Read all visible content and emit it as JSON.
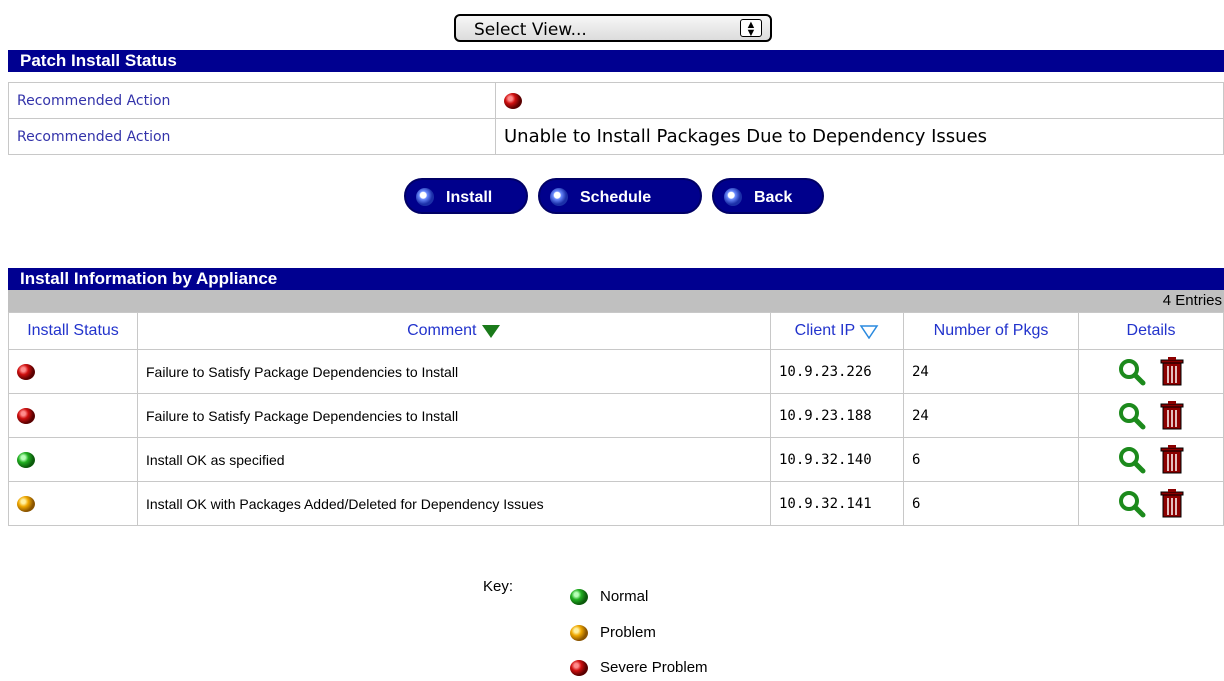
{
  "select_view": {
    "label": "Select View..."
  },
  "patch_status": {
    "header": "Patch Install Status",
    "rows": [
      {
        "label": "Recommended Action",
        "value": "",
        "status": "red"
      },
      {
        "label": "Recommended Action",
        "value": "Unable to Install Packages Due to Dependency Issues"
      }
    ]
  },
  "buttons": {
    "install": "Install",
    "schedule": "Schedule",
    "back": "Back"
  },
  "install_info": {
    "header": "Install Information by Appliance",
    "entries": "4 Entries",
    "columns": {
      "install_status": "Install Status",
      "comment": "Comment",
      "client_ip": "Client IP",
      "num_pkgs": "Number of Pkgs",
      "details": "Details"
    },
    "rows": [
      {
        "status": "red",
        "comment": "Failure to Satisfy Package Dependencies to Install",
        "ip": "10.9.23.226",
        "pkgs": "24"
      },
      {
        "status": "red",
        "comment": "Failure to Satisfy Package Dependencies to Install",
        "ip": "10.9.23.188",
        "pkgs": "24"
      },
      {
        "status": "green",
        "comment": "Install OK as specified",
        "ip": "10.9.32.140",
        "pkgs": "6"
      },
      {
        "status": "orange",
        "comment": "Install OK with Packages Added/Deleted for Dependency Issues",
        "ip": "10.9.32.141",
        "pkgs": "6"
      }
    ]
  },
  "key": {
    "label": "Key:",
    "items": [
      {
        "color": "green",
        "label": "Normal"
      },
      {
        "color": "orange",
        "label": "Problem"
      },
      {
        "color": "red",
        "label": "Severe Problem"
      }
    ]
  },
  "colors": {
    "header_bg": "#000090",
    "button_bg": "#00008c",
    "link_blue": "#2233cc",
    "bar_gray": "#c0c0c0"
  }
}
